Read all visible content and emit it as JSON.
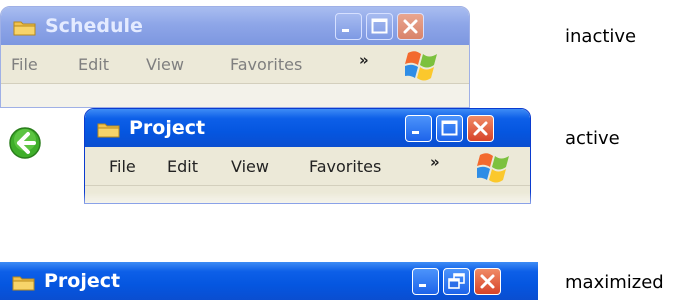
{
  "windows": {
    "inactive": {
      "title": "Schedule",
      "state_label": "inactive",
      "menu": [
        "File",
        "Edit",
        "View",
        "Favorites"
      ],
      "overflow": "»"
    },
    "active": {
      "title": "Project",
      "state_label": "active",
      "menu": [
        "File",
        "Edit",
        "View",
        "Favorites"
      ],
      "overflow": "»"
    },
    "maximized": {
      "title": "Project",
      "state_label": "maximized"
    }
  },
  "colors": {
    "active_title": "#0556e0",
    "inactive_title": "#8ea6e8",
    "close_active": "#d6432a",
    "close_inactive": "#d9836a"
  },
  "icons": [
    "folder-icon",
    "minimize-icon",
    "maximize-icon",
    "restore-icon",
    "close-icon",
    "back-arrow-icon",
    "windows-logo-icon"
  ]
}
